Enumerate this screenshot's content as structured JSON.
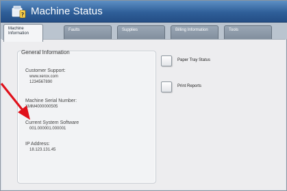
{
  "window": {
    "title": "Machine Status"
  },
  "tabs": [
    {
      "label": "Machine Information",
      "active": true
    },
    {
      "label": "Faults",
      "active": false
    },
    {
      "label": "Supplies",
      "active": false
    },
    {
      "label": "Billing Information",
      "active": false
    },
    {
      "label": "Tools",
      "active": false
    }
  ],
  "general_info": {
    "title": "General Information",
    "customer_support_label": "Customer Support:",
    "customer_support_url": "www.xerox.com",
    "customer_support_phone": "1234567890",
    "serial_label": "Machine Serial Number:",
    "serial_value": "XMM4000000505",
    "software_label": "Current System Software",
    "software_value": "001.000001.000001",
    "ip_label": "IP Address:",
    "ip_value": "18.123.131.45"
  },
  "actions": {
    "paper_tray_status": "Paper Tray Status",
    "print_reports": "Print Reports"
  },
  "colors": {
    "titlebar": "#2f5f99",
    "annotation_arrow": "#e0101a"
  },
  "icons": [
    "machine-status-icon",
    "annotation-arrow-icon"
  ]
}
